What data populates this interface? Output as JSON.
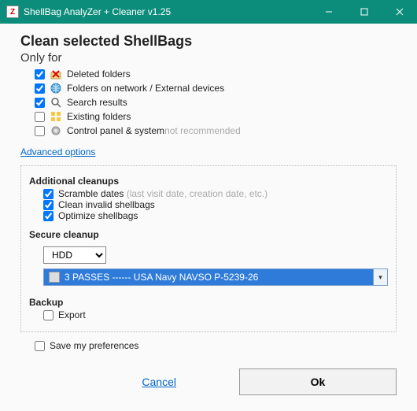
{
  "window": {
    "title": "ShellBag  AnalyZer + Cleaner v1.25"
  },
  "header": {
    "main": "Clean selected ShellBags",
    "sub": "Only for"
  },
  "options": {
    "deleted": {
      "label": "Deleted folders",
      "checked": true
    },
    "network": {
      "label": "Folders on network / External devices",
      "checked": true
    },
    "search": {
      "label": "Search results",
      "checked": true
    },
    "existing": {
      "label": "Existing folders",
      "checked": false
    },
    "cpanel": {
      "label": "Control panel & system",
      "suffix": "not recommended",
      "checked": false
    }
  },
  "advanced_link": "Advanced options",
  "additional": {
    "title": "Additional cleanups",
    "scramble": {
      "label": "Scramble dates",
      "hint": "(last visit date, creation date, etc.)",
      "checked": true
    },
    "invalid": {
      "label": "Clean invalid shellbags",
      "checked": true
    },
    "optimize": {
      "label": "Optimize shellbags",
      "checked": true
    }
  },
  "secure": {
    "title": "Secure cleanup",
    "drive_selected": "HDD",
    "passes_selected": "3 PASSES   ------    USA Navy NAVSO P-5239-26"
  },
  "backup": {
    "title": "Backup",
    "export": {
      "label": "Export",
      "checked": false
    }
  },
  "save_pref": {
    "label": "Save my preferences",
    "checked": false
  },
  "buttons": {
    "cancel": "Cancel",
    "ok": "Ok"
  }
}
